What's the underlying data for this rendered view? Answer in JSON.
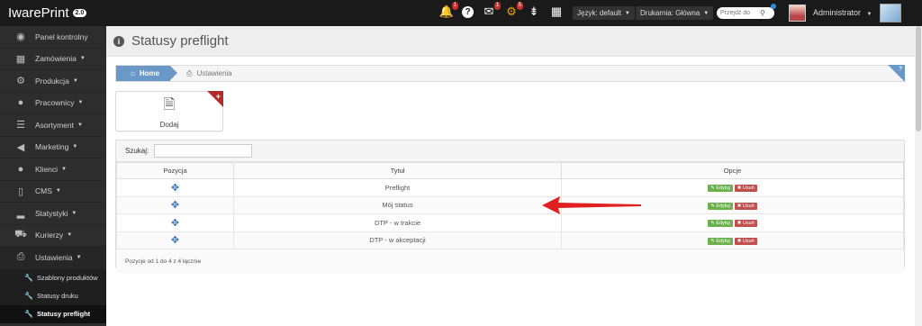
{
  "brand": {
    "name": "IwarePrint",
    "version": "2.0"
  },
  "topbar": {
    "icons": [
      {
        "name": "bell-icon",
        "glyph": "🔔",
        "badge": "1"
      },
      {
        "name": "help-icon",
        "glyph": "?",
        "badge": ""
      },
      {
        "name": "mail-icon",
        "glyph": "✉",
        "badge": "1"
      },
      {
        "name": "gear-icon",
        "glyph": "⚙",
        "badge": "5"
      },
      {
        "name": "sort-icon",
        "glyph": "⇟",
        "badge": ""
      },
      {
        "name": "qr-icon",
        "glyph": "▦",
        "badge": ""
      }
    ],
    "language": "Język: default",
    "printer": "Drukarnia: Główna",
    "search_placeholder": "Przejdź do",
    "user": "Administrator"
  },
  "sidebar": {
    "items": [
      {
        "label": "Panel kontrolny",
        "icon": "dashboard-icon",
        "glyph": "◉"
      },
      {
        "label": "Zamówienia",
        "icon": "table-icon",
        "glyph": "▦"
      },
      {
        "label": "Produkcja",
        "icon": "cogs-icon",
        "glyph": "⚙"
      },
      {
        "label": "Pracownicy",
        "icon": "user-icon",
        "glyph": "●"
      },
      {
        "label": "Asortyment",
        "icon": "list-icon",
        "glyph": "☰"
      },
      {
        "label": "Marketing",
        "icon": "megaphone-icon",
        "glyph": "📢"
      },
      {
        "label": "Klienci",
        "icon": "client-icon",
        "glyph": "●"
      },
      {
        "label": "CMS",
        "icon": "file-icon",
        "glyph": "▯"
      },
      {
        "label": "Statystyki",
        "icon": "signal-icon",
        "glyph": "▂"
      },
      {
        "label": "Kurierzy",
        "icon": "truck-icon",
        "glyph": "⛟"
      },
      {
        "label": "Ustawienia",
        "icon": "printer-icon",
        "glyph": "⎙"
      }
    ],
    "subitems": [
      {
        "label": "Szablony produktów"
      },
      {
        "label": "Statusy druku"
      },
      {
        "label": "Statusy preflight"
      }
    ]
  },
  "page": {
    "title": "Statusy preflight",
    "breadcrumb_home": "Home",
    "breadcrumb_current": "Ustawienia",
    "help": "?",
    "add_label": "Dodaj",
    "search_label": "Szukaj:"
  },
  "table": {
    "headers": [
      "Pozycja",
      "Tytuł",
      "Opcje"
    ],
    "rows": [
      {
        "title": "Preflight"
      },
      {
        "title": "Mój status"
      },
      {
        "title": "DTP - w trakcie"
      },
      {
        "title": "DTP - w akceptacji"
      }
    ],
    "edit_label": "✎ Edytuj",
    "delete_label": "✖ Usuń",
    "footer": "Pozycje od 1 do 4 z 4 łącznie"
  },
  "colors": {
    "accent": "#6a99c8",
    "edit": "#6ab04c",
    "delete": "#c0504d",
    "arrow": "#e02020"
  }
}
